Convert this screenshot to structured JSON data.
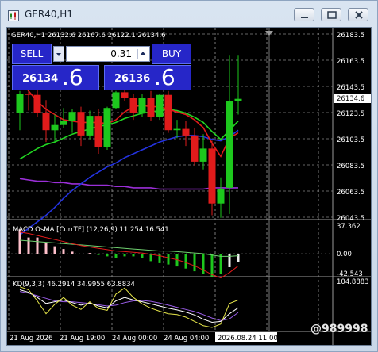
{
  "window": {
    "title": "GER40,H1"
  },
  "chart": {
    "info_line": "GER40,H1  26132.6 26167.6 26122.1 26134.6",
    "price_labels": [
      "26183.5",
      "26163.5",
      "26143.5",
      "26123.5",
      "26103.5",
      "26083.5",
      "26063.5",
      "26043.5"
    ],
    "current_price_label": "26134.6",
    "macd_label": "MACD OsMA [CurrTF] (12,26,9) 11.254 16.541",
    "macd_scale": [
      "37.362",
      "0.00",
      "-42.543"
    ],
    "kd_label": "KD(9,3,3) 46.2914 34.9955 63.8834",
    "kd_scale": [
      "104.8883"
    ],
    "time_labels": [
      "21 Aug 2026",
      "21 Aug 19:00",
      "24 Aug 00:00",
      "24 Aug 04:00"
    ],
    "time_highlight": "2026.08.24 11:00",
    "watermark": "@989998"
  },
  "trade_panel": {
    "sell_label": "SELL",
    "buy_label": "BUY",
    "lot": "0.31",
    "sell_price_main": "26134",
    "sell_price_big": ".6",
    "buy_price_main": "26136",
    "buy_price_big": ".6"
  },
  "colors": {
    "bull": "#1dc81d",
    "bear": "#e11b1b",
    "ma_fast": "#e11b1b",
    "ma_mid": "#22d622",
    "ma_slow": "#2433e0",
    "ma_long": "#9b2fd8",
    "panel_blue": "#2626c8"
  },
  "candles": [
    {
      "o": 26123,
      "h": 26140,
      "l": 26110,
      "c": 26138
    },
    {
      "o": 26138,
      "h": 26142,
      "l": 26125,
      "c": 26137
    },
    {
      "o": 26137,
      "h": 26142,
      "l": 26120,
      "c": 26123
    },
    {
      "o": 26123,
      "h": 26133,
      "l": 26101,
      "c": 26110
    },
    {
      "o": 26110,
      "h": 26122,
      "l": 26100,
      "c": 26114
    },
    {
      "o": 26114,
      "h": 26127,
      "l": 26112,
      "c": 26117
    },
    {
      "o": 26117,
      "h": 26126,
      "l": 26108,
      "c": 26124
    },
    {
      "o": 26124,
      "h": 26128,
      "l": 26098,
      "c": 26106
    },
    {
      "o": 26106,
      "h": 26125,
      "l": 26103,
      "c": 26121
    },
    {
      "o": 26121,
      "h": 26126,
      "l": 26092,
      "c": 26097
    },
    {
      "o": 26097,
      "h": 26128,
      "l": 26095,
      "c": 26127
    },
    {
      "o": 26127,
      "h": 26140,
      "l": 26126,
      "c": 26139
    },
    {
      "o": 26139,
      "h": 26144,
      "l": 26132,
      "c": 26135
    },
    {
      "o": 26135,
      "h": 26138,
      "l": 26118,
      "c": 26123
    },
    {
      "o": 26123,
      "h": 26138,
      "l": 26120,
      "c": 26135
    },
    {
      "o": 26135,
      "h": 26140,
      "l": 26117,
      "c": 26120
    },
    {
      "o": 26120,
      "h": 26138,
      "l": 26118,
      "c": 26137
    },
    {
      "o": 26137,
      "h": 26140,
      "l": 26108,
      "c": 26110
    },
    {
      "o": 26110,
      "h": 26118,
      "l": 26104,
      "c": 26111
    },
    {
      "o": 26111,
      "h": 26117,
      "l": 26098,
      "c": 26106
    },
    {
      "o": 26106,
      "h": 26112,
      "l": 26083,
      "c": 26086
    },
    {
      "o": 26086,
      "h": 26107,
      "l": 26080,
      "c": 26096
    },
    {
      "o": 26096,
      "h": 26102,
      "l": 26045,
      "c": 26054
    },
    {
      "o": 26054,
      "h": 26074,
      "l": 26043,
      "c": 26065
    },
    {
      "o": 26066,
      "h": 26167,
      "l": 26046,
      "c": 26132
    },
    {
      "o": 26132,
      "h": 26167,
      "l": 26122,
      "c": 26134
    }
  ],
  "ma_fast_values": [
    26150,
    26140,
    26132,
    26126,
    26122,
    26118,
    26117,
    26116,
    26116,
    26116,
    26115,
    26118,
    26124,
    26128,
    26129,
    26128,
    26128,
    26126,
    26124,
    26122,
    26118,
    26112,
    26100,
    26090,
    26104,
    26108
  ],
  "ma_mid_values": [
    26088,
    26092,
    26096,
    26099,
    26101,
    26104,
    26107,
    26109,
    26111,
    26113,
    26114,
    26116,
    26119,
    26121,
    26123,
    26124,
    26125,
    26126,
    26125,
    26123,
    26120,
    26116,
    26109,
    26103,
    26110,
    26117
  ],
  "ma_slow_values": [
    26030,
    26035,
    26040,
    26045,
    26051,
    26058,
    26064,
    26069,
    26074,
    26078,
    26082,
    26085,
    26089,
    26092,
    26095,
    26098,
    26101,
    26103,
    26105,
    26106,
    26106,
    26105,
    26103,
    26102,
    26105,
    26110
  ],
  "ma_long_values": [
    26073,
    26072,
    26071,
    26071,
    26070,
    26070,
    26069,
    26069,
    26068,
    26068,
    26068,
    26067,
    26067,
    26066,
    26066,
    26066,
    26065,
    26065,
    26065,
    26065,
    26065,
    26065,
    26066,
    26066,
    26066,
    26066
  ],
  "macd_hist": [
    36,
    24,
    24,
    16,
    11,
    7,
    3,
    0,
    1,
    -2,
    -4,
    -6,
    -4,
    -4,
    -7,
    -11,
    -14,
    -16,
    -19,
    -22,
    -26,
    -30,
    -34,
    -30,
    -20,
    -12
  ],
  "macd_signal": [
    20,
    19,
    18,
    17,
    16,
    15,
    14,
    13,
    12,
    11,
    10,
    9,
    8,
    7,
    6,
    5,
    4,
    4,
    3,
    2,
    1,
    0,
    -2,
    -4,
    -4,
    -3
  ],
  "macd_line": [
    32,
    30,
    27,
    24,
    21,
    18,
    15,
    12,
    10,
    8,
    6,
    4,
    3,
    2,
    1,
    -1,
    -3,
    -6,
    -9,
    -13,
    -18,
    -24,
    -31,
    -36,
    -28,
    -18
  ],
  "kd_k": [
    88,
    82,
    70,
    56,
    60,
    64,
    58,
    52,
    57,
    50,
    46,
    62,
    70,
    64,
    60,
    55,
    50,
    45,
    41,
    36,
    29,
    19,
    12,
    14,
    32,
    46
  ],
  "kd_d": [
    84,
    80,
    74,
    68,
    62,
    60,
    60,
    58,
    56,
    53,
    50,
    52,
    58,
    62,
    63,
    61,
    57,
    52,
    47,
    42,
    37,
    30,
    22,
    16,
    20,
    35
  ],
  "kd_j": [
    95,
    88,
    62,
    32,
    54,
    70,
    52,
    42,
    60,
    44,
    40,
    78,
    92,
    70,
    55,
    45,
    38,
    32,
    30,
    24,
    14,
    4,
    0,
    8,
    56,
    64
  ]
}
